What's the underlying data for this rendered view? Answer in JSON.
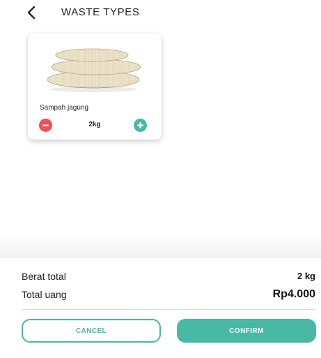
{
  "header": {
    "title": "WASTE TYPES",
    "back_icon": "chevron-left-icon"
  },
  "waste_item": {
    "name": "Sampah jagung",
    "quantity": "2kg",
    "image": "corn-cobs-image",
    "minus_icon": "minus-circle-icon",
    "plus_icon": "plus-circle-icon"
  },
  "summary": {
    "weight_label": "Berat total",
    "weight_value": "2 kg",
    "money_label": "Total uang",
    "money_value": "Rp4.000"
  },
  "actions": {
    "cancel_label": "CANCEL",
    "confirm_label": "CONFIRM"
  },
  "colors": {
    "accent": "#47b9a5",
    "minus": "#ef4f55",
    "text": "#222222"
  }
}
